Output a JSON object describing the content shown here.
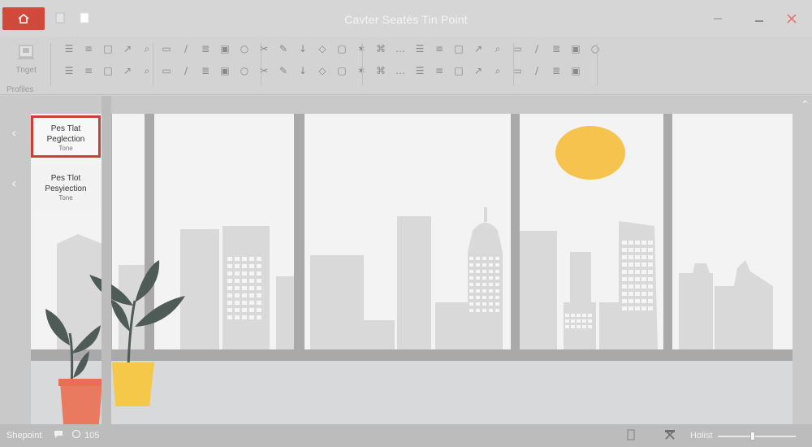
{
  "window": {
    "title": "Cavter Seatés Tin Point"
  },
  "ribbon": {
    "first_button_label": "Tnget",
    "group_label": "Profiles",
    "row1_icons": [
      "text-style-1",
      "text-style-2",
      "text-style-3",
      "text-style-4",
      "text-style-5",
      "align-menu",
      "up-arrow",
      "search",
      "text-a",
      "shape",
      "lines",
      "italic-lines",
      "list",
      "layout",
      "rectangle",
      "page",
      "document",
      "table",
      "bucket",
      "key",
      "pen-key",
      "pencil",
      "pen",
      "grid",
      "globe",
      "close-x",
      "brush",
      "paste"
    ],
    "row2_icons": [
      "arrow-left",
      "arrow-right",
      "equals",
      "list-dash",
      "check",
      "marker",
      "pencil-2",
      "eraser",
      "pin",
      "dashed-line",
      "chart-lines",
      "chevron",
      "sticky-note",
      "lock",
      "palette",
      "columns",
      "settings-gear",
      "frame",
      "rectangle-blank",
      "dots",
      "stamp",
      "film",
      "bottle",
      "person",
      "sort",
      "lock-menu",
      "more-vertical"
    ]
  },
  "thumbnails": [
    {
      "title": "Pes Tlat",
      "subtitle": "Peglection",
      "caption": "Tone",
      "active": true
    },
    {
      "title": "Pes Tlot",
      "subtitle": "Pesyiection",
      "caption": "Tone",
      "active": false
    }
  ],
  "colors": {
    "accent": "#cd3e34",
    "sun": "#f6c34f",
    "pot_left": "#ea7a5f",
    "pot_right": "#f6c84a",
    "leaf": "#4f5b56",
    "frame": "#a9a9a9",
    "sky": "#f2f2f2",
    "buildings": "#d9d9d9"
  },
  "status": {
    "left_label": "Shepoint",
    "count": "105",
    "zoom_label": "Holist"
  }
}
